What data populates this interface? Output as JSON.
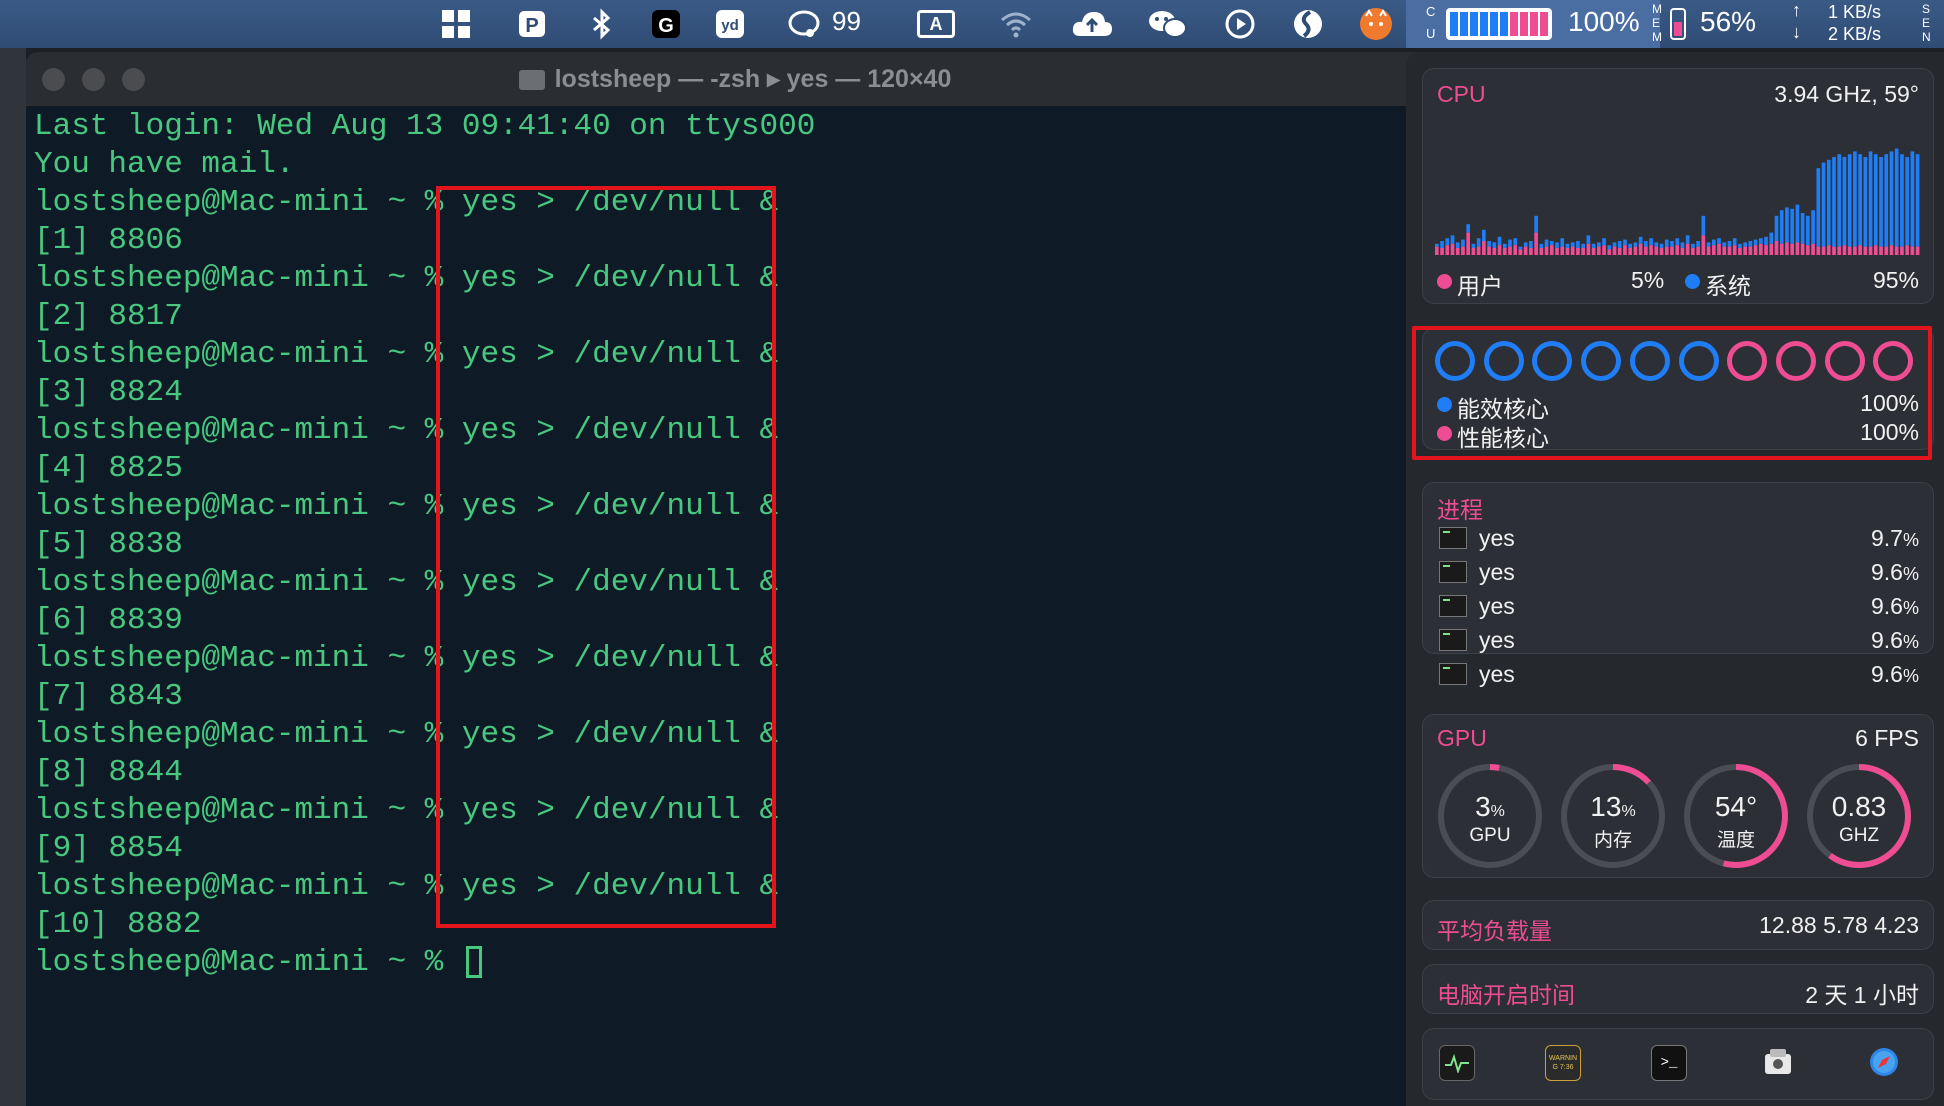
{
  "menubar": {
    "notification_count": "99",
    "input_source": "A",
    "cpu_label_top": "C",
    "cpu_label_bottom": "U",
    "cpu_percent": "100%",
    "mem_label_top": "M",
    "mem_label_mid": "E",
    "mem_label_bottom": "M",
    "mem_percent": "56%",
    "net_up": "1 KB/s",
    "net_down": "2 KB/s",
    "sen_top": "S",
    "sen_mid": "E",
    "sen_bottom": "N",
    "icons": [
      "windows-grid-icon",
      "parallels-icon",
      "bluetooth-icon",
      "g-hub-icon",
      "youdao-dict-icon",
      "chat-icon",
      "input-source-icon",
      "wifi-icon",
      "cloud-upload-icon",
      "wechat-icon",
      "play-icon",
      "sync-icon",
      "cat-app-icon"
    ]
  },
  "terminal": {
    "title": "lostsheep — -zsh ▸ yes — 120×40",
    "lines": [
      "Last login: Wed Aug 13 09:41:40 on ttys000",
      "You have mail.",
      "lostsheep@Mac-mini ~ % yes > /dev/null &",
      "[1] 8806",
      "lostsheep@Mac-mini ~ % yes > /dev/null &",
      "[2] 8817",
      "lostsheep@Mac-mini ~ % yes > /dev/null &",
      "[3] 8824",
      "lostsheep@Mac-mini ~ % yes > /dev/null &",
      "[4] 8825",
      "lostsheep@Mac-mini ~ % yes > /dev/null &",
      "[5] 8838",
      "lostsheep@Mac-mini ~ % yes > /dev/null &",
      "[6] 8839",
      "lostsheep@Mac-mini ~ % yes > /dev/null &",
      "[7] 8843",
      "lostsheep@Mac-mini ~ % yes > /dev/null &",
      "[8] 8844",
      "lostsheep@Mac-mini ~ % yes > /dev/null &",
      "[9] 8854",
      "lostsheep@Mac-mini ~ % yes > /dev/null &",
      "[10] 8882"
    ],
    "prompt": "lostsheep@Mac-mini ~ % "
  },
  "cpu": {
    "title": "CPU",
    "freq_temp": "3.94 GHz, 59°",
    "user_label": "用户",
    "user_value": "5%",
    "system_label": "系统",
    "system_value": "95%",
    "history_system": [
      8,
      10,
      12,
      14,
      9,
      11,
      22,
      8,
      12,
      18,
      10,
      9,
      13,
      8,
      11,
      12,
      6,
      9,
      10,
      28,
      8,
      11,
      10,
      9,
      12,
      8,
      9,
      10,
      8,
      14,
      8,
      9,
      12,
      7,
      9,
      10,
      11,
      8,
      9,
      13,
      10,
      12,
      9,
      8,
      11,
      10,
      12,
      9,
      14,
      8,
      10,
      28,
      9,
      11,
      12,
      9,
      10,
      12,
      8,
      9,
      10,
      11,
      12,
      13,
      16,
      28,
      32,
      34,
      33,
      36,
      30,
      28,
      32,
      62,
      66,
      68,
      70,
      72,
      70,
      72,
      74,
      72,
      70,
      74,
      72,
      70,
      72,
      74,
      76,
      72,
      70,
      74,
      72
    ],
    "history_user": [
      6,
      5,
      7,
      8,
      5,
      6,
      16,
      5,
      6,
      10,
      6,
      5,
      7,
      5,
      6,
      7,
      4,
      6,
      5,
      16,
      5,
      6,
      7,
      5,
      6,
      5,
      6,
      5,
      5,
      8,
      5,
      6,
      7,
      4,
      6,
      5,
      7,
      5,
      6,
      8,
      6,
      7,
      6,
      5,
      6,
      6,
      7,
      5,
      8,
      5,
      6,
      14,
      6,
      7,
      8,
      6,
      6,
      7,
      5,
      6,
      6,
      7,
      8,
      7,
      8,
      10,
      8,
      9,
      8,
      9,
      8,
      7,
      8,
      6,
      6,
      7,
      6,
      6,
      7,
      6,
      6,
      7,
      6,
      6,
      7,
      6,
      6,
      7,
      6,
      6,
      7,
      6,
      6
    ]
  },
  "cores": {
    "efficiency_label": "能效核心",
    "efficiency_value": "100%",
    "performance_label": "性能核心",
    "performance_value": "100%",
    "efficiency_count": 6,
    "performance_count": 4
  },
  "processes": {
    "title": "进程",
    "items": [
      {
        "name": "yes",
        "value": "9.7",
        "unit": "%"
      },
      {
        "name": "yes",
        "value": "9.6",
        "unit": "%"
      },
      {
        "name": "yes",
        "value": "9.6",
        "unit": "%"
      },
      {
        "name": "yes",
        "value": "9.6",
        "unit": "%"
      },
      {
        "name": "yes",
        "value": "9.6",
        "unit": "%"
      }
    ]
  },
  "gpu": {
    "title": "GPU",
    "fps": "6 FPS",
    "gauges": [
      {
        "value": "3",
        "unit": "%",
        "label": "GPU",
        "fraction": 0.03
      },
      {
        "value": "13",
        "unit": "%",
        "label": "内存",
        "fraction": 0.13
      },
      {
        "value": "54°",
        "unit": "",
        "label": "温度",
        "fraction": 0.54
      },
      {
        "value": "0.83",
        "unit": "",
        "label": "GHZ",
        "fraction": 0.6
      }
    ]
  },
  "load": {
    "label": "平均负载量",
    "value": "12.88 5.78 4.23"
  },
  "uptime": {
    "label": "电脑开启时间",
    "value": "2 天 1 小时"
  },
  "dock": {
    "warning_text": "WARNIN",
    "warning_time": "G 7:36"
  },
  "colors": {
    "accent_pink": "#ee4d93",
    "accent_blue": "#1f7df5",
    "terminal_green": "#48c77f",
    "highlight_red": "#e3141b"
  }
}
